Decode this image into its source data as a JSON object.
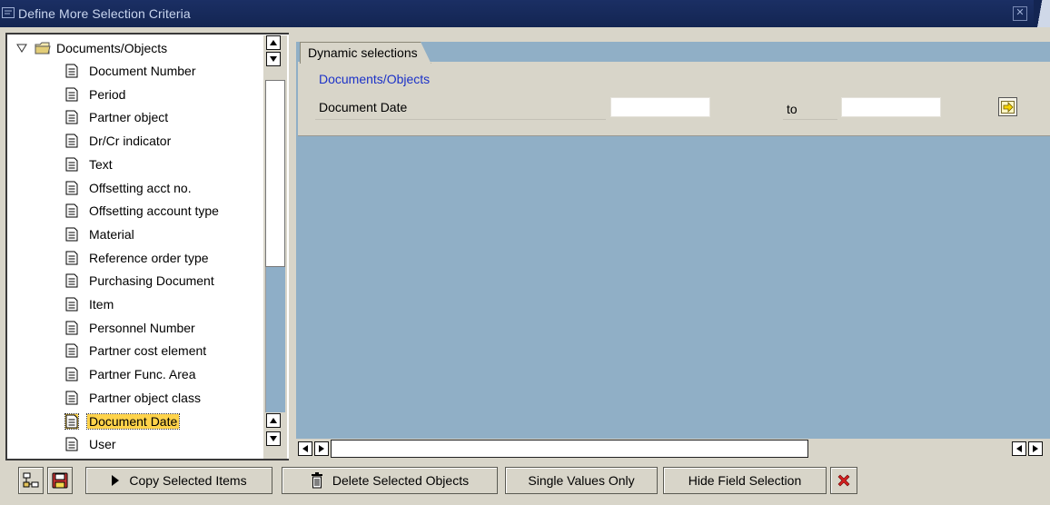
{
  "window": {
    "title": "Define More Selection Criteria"
  },
  "tree": {
    "root_label": "Documents/Objects",
    "items": [
      "Document Number",
      "Period",
      "Partner object",
      "Dr/Cr indicator",
      "Text",
      "Offsetting acct no.",
      "Offsetting account type",
      "Material",
      "Reference order type",
      "Purchasing Document",
      "Item",
      "Personnel Number",
      "Partner cost element",
      "Partner Func. Area",
      "Partner object class",
      "Document Date",
      "User"
    ],
    "selected_index": 15
  },
  "dynamic_selections": {
    "tab_label": "Dynamic selections",
    "section_title": "Documents/Objects",
    "field_label": "Document Date",
    "from_value": "",
    "to_label": "to",
    "to_value": ""
  },
  "toolbar": {
    "copy_label": "Copy Selected Items",
    "delete_label": "Delete Selected Objects",
    "single_values_label": "Single Values Only",
    "hide_field_label": "Hide Field Selection"
  },
  "colors": {
    "title_bar": "#132552",
    "selection_highlight": "#ffd34a",
    "content_background": "#90afc6",
    "section_title": "#1c32c8",
    "cancel_icon": "#d42020"
  }
}
